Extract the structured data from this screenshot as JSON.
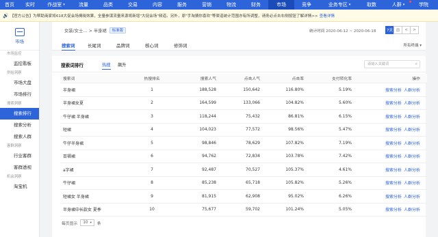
{
  "topnav": {
    "items": [
      {
        "label": "首页"
      },
      {
        "label": "实时"
      },
      {
        "label": "作战室",
        "dropdown": true
      },
      {
        "label": "流量"
      },
      {
        "label": "品类"
      },
      {
        "label": "交易"
      },
      {
        "label": "内容"
      },
      {
        "label": "服务"
      },
      {
        "label": "营销"
      },
      {
        "label": "物流"
      },
      {
        "label": "财务"
      },
      {
        "label": "市场",
        "active": true
      },
      {
        "label": "竞争"
      },
      {
        "label": "业务专区",
        "dropdown": true
      },
      {
        "label": "取数"
      },
      {
        "label": "人群",
        "dropdown": true
      },
      {
        "label": "学院"
      }
    ]
  },
  "notice": {
    "text": "【官方公告】为帮助商家将618大促会场揭晓效果，全量参谋流量来源将新增\"大促会场\"频道。另外，原\"手淘猜你喜欢\"等渠道统计范围亦有所调整，请务必点击右侧按钮了解详情>>",
    "link": "查看详情"
  },
  "sidebar": {
    "header_label": "市场",
    "sections": [
      {
        "title": "市场监控",
        "items": [
          "监控看板"
        ]
      },
      {
        "title": "供给洞察",
        "items": [
          "市场大盘",
          "市场排行"
        ]
      },
      {
        "title": "搜索洞察",
        "items": [
          "搜索排行",
          "搜索分析",
          "搜索人群"
        ]
      },
      {
        "title": "客群洞察",
        "items": [
          "行业客群",
          "客群透视"
        ]
      },
      {
        "title": "机会洞察",
        "items": [
          "淘宝机"
        ]
      }
    ],
    "active_item": "搜索排行"
  },
  "breadcrumb": {
    "path": "女装/女士… > 半身裙",
    "badge": "标准版"
  },
  "date": {
    "range_text": "统计时间 2020-06-12 ~ 2020-06-18",
    "buttons": [
      "7天",
      "日",
      "<",
      ">"
    ],
    "active_button": "7天"
  },
  "tabs": {
    "items": [
      "搜索词",
      "长尾词",
      "品牌词",
      "核心词",
      "修饰词"
    ],
    "active": "搜索词",
    "terminal": "所有终端"
  },
  "rank": {
    "title": "搜索词排行",
    "subtabs": [
      "热搜",
      "飙升"
    ],
    "active_subtab": "热搜",
    "search_placeholder": "请输入关键词"
  },
  "table": {
    "columns": [
      "搜索词",
      "热搜排名",
      "搜索人气",
      "点击人气",
      "点击率",
      "支付转化率",
      "操作"
    ],
    "rows": [
      {
        "term": "半身裙",
        "rank": "1",
        "search": "188,528",
        "click": "150,642",
        "ctr": "116.80%",
        "cvr": "5.19%"
      },
      {
        "term": "半身裙女夏",
        "rank": "2",
        "search": "164,599",
        "click": "133,066",
        "ctr": "104.82%",
        "cvr": "5.60%"
      },
      {
        "term": "牛仔裙 半身裙",
        "rank": "3",
        "search": "118,244",
        "click": "75,432",
        "ctr": "86.81%",
        "cvr": "6.15%"
      },
      {
        "term": "短裙",
        "rank": "4",
        "search": "104,023",
        "click": "77,572",
        "ctr": "98.56%",
        "cvr": "5.47%"
      },
      {
        "term": "牛仔半身裙",
        "rank": "5",
        "search": "98,846",
        "click": "78,629",
        "ctr": "107.82%",
        "cvr": "7.19%"
      },
      {
        "term": "百褶裙",
        "rank": "6",
        "search": "94,762",
        "click": "72,834",
        "ctr": "103.78%",
        "cvr": "7.42%"
      },
      {
        "term": "a字裙",
        "rank": "7",
        "search": "92,487",
        "click": "70,527",
        "ctr": "105.37%",
        "cvr": "4.61%"
      },
      {
        "term": "牛仔裙",
        "rank": "8",
        "search": "85,238",
        "click": "65,718",
        "ctr": "105.82%",
        "cvr": "5.26%"
      },
      {
        "term": "短裙女 半身裙",
        "rank": "9",
        "search": "81,915",
        "click": "62,908",
        "ctr": "95.02%",
        "cvr": "6.26%"
      },
      {
        "term": "半身裙中长款女 夏季",
        "rank": "10",
        "search": "75,677",
        "click": "59,702",
        "ctr": "101.24%",
        "cvr": "5.05%"
      }
    ],
    "action_links": [
      "搜索分析",
      "人群分析"
    ]
  },
  "pager": {
    "prefix": "每页显示",
    "value": "10",
    "suffix": "条"
  }
}
